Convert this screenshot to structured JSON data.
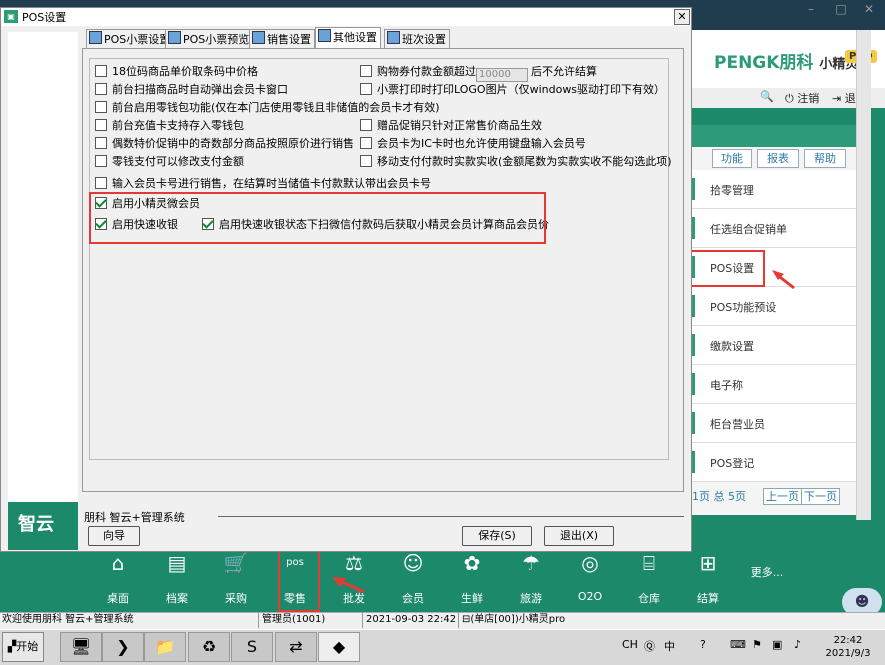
{
  "background_app": {
    "title_fragment": "朋科 智云 管理系统",
    "brand_name": "PENGK朋科",
    "brand_product": "小精灵",
    "brand_tag": "PRO",
    "toolbar": {
      "logout": "注销",
      "exit": "退出"
    },
    "panel_tabs": [
      "功能",
      "报表",
      "帮助"
    ],
    "menu_items": [
      "拾零管理",
      "任选组合促销单",
      "POS设置",
      "POS功能预设",
      "缴款设置",
      "电子称",
      "柜台营业员",
      "POS登记"
    ],
    "pager": {
      "text": "1页 总 5页",
      "prev": "上一页",
      "next": "下一页"
    },
    "bottom_nav": [
      "桌面",
      "档案",
      "采购",
      "零售",
      "批发",
      "会员",
      "生鲜",
      "旅游",
      "O2O",
      "仓库",
      "结算",
      "更多..."
    ],
    "pos_icon_text": "pos",
    "status_bar": {
      "welcome": "欢迎使用朋科 智云+管理系统",
      "user": "管理员(1001)",
      "datetime": "2021-09-03 22:42",
      "store": "(单店[00])小精灵pro"
    }
  },
  "dialog": {
    "title": "POS设置",
    "tabs": [
      {
        "label": "POS小票设置",
        "active": false
      },
      {
        "label": "POS小票预览",
        "active": false
      },
      {
        "label": "销售设置",
        "active": false
      },
      {
        "label": "其他设置",
        "active": true
      },
      {
        "label": "班次设置",
        "active": false
      }
    ],
    "options": [
      {
        "label": "18位码商品单价取条码中价格",
        "checked": false
      },
      {
        "label": "购物券付款金额超过",
        "suffix": "后不允许结算",
        "value": "10000",
        "checked": false
      },
      {
        "label": "前台扫描商品时自动弹出会员卡窗口",
        "checked": false
      },
      {
        "label": "小票打印时打印LOGO图片（仅windows驱动打印下有效）",
        "checked": false
      },
      {
        "label": "前台启用零钱包功能(仅在本门店使用零钱且非储值的会员卡才有效)",
        "checked": false
      },
      {
        "label": "前台充值卡支持存入零钱包",
        "checked": false
      },
      {
        "label": "赠品促销只针对正常售价商品生效",
        "checked": false
      },
      {
        "label": "偶数特价促销中的奇数部分商品按照原价进行销售",
        "checked": false
      },
      {
        "label": "会员卡为IC卡时也允许使用键盘输入会员号",
        "checked": false
      },
      {
        "label": "零钱支付可以修改支付金额",
        "checked": false
      },
      {
        "label": "移动支付付款时实款实收(金额尾数为实款实收不能勾选此项)",
        "checked": false
      },
      {
        "label": "输入会员卡号进行销售，在结算时当储值卡付款默认带出会员卡号",
        "checked": false
      },
      {
        "label": "启用小精灵微会员",
        "checked": true
      },
      {
        "label": "启用快速收银",
        "checked": true
      },
      {
        "label": "启用快速收银状态下扫微信付款码后获取小精灵会员计算商品会员价",
        "checked": true
      }
    ],
    "footer_label": "朋科 智云+管理系统",
    "buttons": {
      "guide": "向导",
      "save": "保存(S)",
      "exit": "退出(X)"
    },
    "sidebar_logo": "智云"
  },
  "taskbar": {
    "start": "开始",
    "lang": "CH",
    "time": "22:42",
    "date": "2021/9/3"
  },
  "colors": {
    "accent": "#2d9a78",
    "highlight_box": "#e53935",
    "check": "#0a8a30"
  }
}
